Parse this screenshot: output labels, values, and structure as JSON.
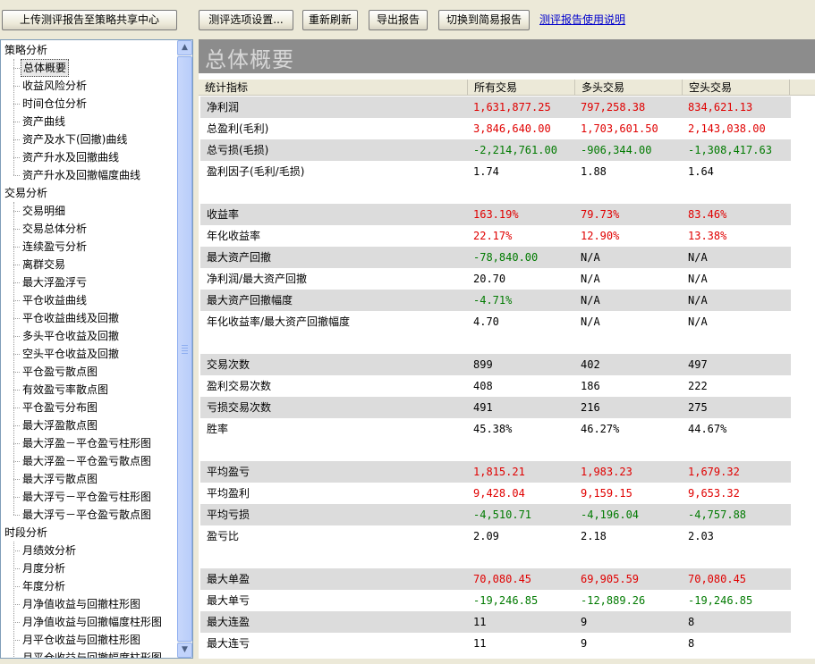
{
  "toolbar": {
    "upload_label": "上传测评报告至策略共享中心",
    "options_label": "测评选项设置...",
    "refresh_label": "重新刷新",
    "export_label": "导出报告",
    "switch_label": "切换到简易报告",
    "help_link": "测评报告使用说明"
  },
  "tree": {
    "groups": [
      {
        "label": "策略分析",
        "items": [
          "总体概要",
          "收益风险分析",
          "时间仓位分析",
          "资产曲线",
          "资产及水下(回撤)曲线",
          "资产升水及回撤曲线",
          "资产升水及回撤幅度曲线"
        ]
      },
      {
        "label": "交易分析",
        "items": [
          "交易明细",
          "交易总体分析",
          "连续盈亏分析",
          "离群交易",
          "最大浮盈浮亏",
          "平仓收益曲线",
          "平仓收益曲线及回撤",
          "多头平仓收益及回撤",
          "空头平仓收益及回撤",
          "平仓盈亏散点图",
          "有效盈亏率散点图",
          "平仓盈亏分布图",
          "最大浮盈散点图",
          "最大浮盈－平仓盈亏柱形图",
          "最大浮盈－平仓盈亏散点图",
          "最大浮亏散点图",
          "最大浮亏－平仓盈亏柱形图",
          "最大浮亏－平仓盈亏散点图"
        ]
      },
      {
        "label": "时段分析",
        "items": [
          "月绩效分析",
          "月度分析",
          "年度分析",
          "月净值收益与回撤柱形图",
          "月净值收益与回撤幅度柱形图",
          "月平仓收益与回撤柱形图",
          "月平仓收益与回撤幅度柱形图"
        ]
      }
    ],
    "selected": "总体概要"
  },
  "report": {
    "title": "总体概要",
    "columns": [
      "统计指标",
      "所有交易",
      "多头交易",
      "空头交易"
    ],
    "sections": [
      [
        {
          "label": "净利润",
          "values": [
            "1,631,877.25",
            "797,258.38",
            "834,621.13"
          ],
          "color": "red"
        },
        {
          "label": "总盈利(毛利)",
          "values": [
            "3,846,640.00",
            "1,703,601.50",
            "2,143,038.00"
          ],
          "color": "red"
        },
        {
          "label": "总亏损(毛损)",
          "values": [
            "-2,214,761.00",
            "-906,344.00",
            "-1,308,417.63"
          ],
          "color": "green"
        },
        {
          "label": "盈利因子(毛利/毛损)",
          "values": [
            "1.74",
            "1.88",
            "1.64"
          ],
          "color": "black"
        }
      ],
      [
        {
          "label": "收益率",
          "values": [
            "163.19%",
            "79.73%",
            "83.46%"
          ],
          "color": "red"
        },
        {
          "label": "年化收益率",
          "values": [
            "22.17%",
            "12.90%",
            "13.38%"
          ],
          "color": "red"
        },
        {
          "label": "最大资产回撤",
          "values": [
            "-78,840.00",
            "N/A",
            "N/A"
          ],
          "color": "green"
        },
        {
          "label": "净利润/最大资产回撤",
          "values": [
            "20.70",
            "N/A",
            "N/A"
          ],
          "color": "black"
        },
        {
          "label": "最大资产回撤幅度",
          "values": [
            "-4.71%",
            "N/A",
            "N/A"
          ],
          "color": "green"
        },
        {
          "label": "年化收益率/最大资产回撤幅度",
          "values": [
            "4.70",
            "N/A",
            "N/A"
          ],
          "color": "black"
        }
      ],
      [
        {
          "label": "交易次数",
          "values": [
            "899",
            "402",
            "497"
          ],
          "color": "black"
        },
        {
          "label": "盈利交易次数",
          "values": [
            "408",
            "186",
            "222"
          ],
          "color": "black"
        },
        {
          "label": "亏损交易次数",
          "values": [
            "491",
            "216",
            "275"
          ],
          "color": "black"
        },
        {
          "label": "胜率",
          "values": [
            "45.38%",
            "46.27%",
            "44.67%"
          ],
          "color": "black"
        }
      ],
      [
        {
          "label": "平均盈亏",
          "values": [
            "1,815.21",
            "1,983.23",
            "1,679.32"
          ],
          "color": "red"
        },
        {
          "label": "平均盈利",
          "values": [
            "9,428.04",
            "9,159.15",
            "9,653.32"
          ],
          "color": "red"
        },
        {
          "label": "平均亏损",
          "values": [
            "-4,510.71",
            "-4,196.04",
            "-4,757.88"
          ],
          "color": "green"
        },
        {
          "label": "盈亏比",
          "values": [
            "2.09",
            "2.18",
            "2.03"
          ],
          "color": "black"
        }
      ],
      [
        {
          "label": "最大单盈",
          "values": [
            "70,080.45",
            "69,905.59",
            "70,080.45"
          ],
          "color": "red"
        },
        {
          "label": "最大单亏",
          "values": [
            "-19,246.85",
            "-12,889.26",
            "-19,246.85"
          ],
          "color": "green"
        },
        {
          "label": "最大连盈",
          "values": [
            "11",
            "9",
            "8"
          ],
          "color": "black"
        },
        {
          "label": "最大连亏",
          "values": [
            "11",
            "9",
            "8"
          ],
          "color": "black"
        }
      ]
    ]
  }
}
